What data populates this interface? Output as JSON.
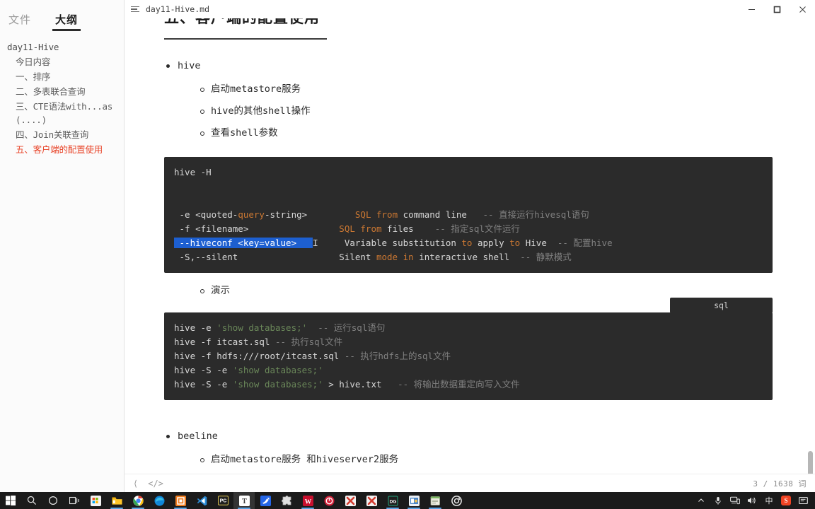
{
  "sidebar": {
    "tabs": [
      {
        "label": "文件",
        "active": false
      },
      {
        "label": "大纲",
        "active": true
      }
    ],
    "outline": [
      {
        "label": "day11-Hive",
        "level": 0,
        "active": false
      },
      {
        "label": "今日内容",
        "level": 1,
        "active": false
      },
      {
        "label": "一、排序",
        "level": 1,
        "active": false
      },
      {
        "label": "二、多表联合查询",
        "level": 1,
        "active": false
      },
      {
        "label": "三、CTE语法with...as(....)",
        "level": 1,
        "active": false
      },
      {
        "label": "四、Join关联查询",
        "level": 1,
        "active": false
      },
      {
        "label": "五、客户端的配置使用",
        "level": 1,
        "active": true
      }
    ],
    "active_color": "#e8452a"
  },
  "window": {
    "title": "day11-Hive.md",
    "menu_icon": "hamburger-icon",
    "controls": {
      "minimize": "minimize-icon",
      "maximize": "restore-icon",
      "close": "close-icon"
    }
  },
  "document": {
    "heading": "五、客户端的配置使用",
    "sections": [
      {
        "bullet": "hive",
        "children": [
          "启动metastore服务",
          "hive的其他shell操作",
          "查看shell参数"
        ]
      }
    ],
    "code_block_1": {
      "lines": [
        [
          {
            "t": "hive -H",
            "c": "txt"
          }
        ],
        [
          {
            "t": "",
            "c": "txt"
          }
        ],
        [
          {
            "t": "",
            "c": "txt"
          }
        ],
        [
          {
            "t": " -e <quoted-",
            "c": "txt"
          },
          {
            "t": "query",
            "c": "kw"
          },
          {
            "t": "-string>         ",
            "c": "txt"
          },
          {
            "t": "SQL from",
            "c": "kw"
          },
          {
            "t": " command line",
            "c": "txt"
          },
          {
            "t": "   -- 直接运行hivesql语句",
            "c": "cmt"
          }
        ],
        [
          {
            "t": " -f <filename>                 ",
            "c": "txt"
          },
          {
            "t": "SQL from",
            "c": "kw"
          },
          {
            "t": " files",
            "c": "txt"
          },
          {
            "t": "    -- 指定sql文件运行",
            "c": "cmt"
          }
        ],
        [
          {
            "t": " --hiveconf <key=value>   ",
            "c": "sel"
          },
          {
            "t": "CARET",
            "c": "caret"
          },
          {
            "t": "     Variable substitution ",
            "c": "txt"
          },
          {
            "t": "to",
            "c": "kw"
          },
          {
            "t": " apply ",
            "c": "txt"
          },
          {
            "t": "to",
            "c": "kw"
          },
          {
            "t": " Hive",
            "c": "txt"
          },
          {
            "t": "  -- 配置hive",
            "c": "cmt"
          }
        ],
        [
          {
            "t": " -S,--silent                   Silent ",
            "c": "txt"
          },
          {
            "t": "mode in",
            "c": "kw"
          },
          {
            "t": " interactive shell",
            "c": "txt"
          },
          {
            "t": "  -- 静默模式",
            "c": "cmt"
          }
        ]
      ]
    },
    "demo_label": "演示",
    "lang_badge": "sql",
    "code_block_2": {
      "lines": [
        [
          {
            "t": "hive -e ",
            "c": "txt"
          },
          {
            "t": "'show databases;'",
            "c": "str"
          },
          {
            "t": "  -- 运行sql语句",
            "c": "cmt"
          }
        ],
        [
          {
            "t": "hive -f itcast.sql",
            "c": "txt"
          },
          {
            "t": " -- 执行sql文件",
            "c": "cmt"
          }
        ],
        [
          {
            "t": "hive -f hdfs:///root/itcast.sql",
            "c": "txt"
          },
          {
            "t": " -- 执行hdfs上的sql文件",
            "c": "cmt"
          }
        ],
        [
          {
            "t": "hive -S -e ",
            "c": "txt"
          },
          {
            "t": "'show databases;'",
            "c": "str"
          }
        ],
        [
          {
            "t": "hive -S -e ",
            "c": "txt"
          },
          {
            "t": "'show databases;'",
            "c": "str"
          },
          {
            "t": " > hive.txt",
            "c": "txt"
          },
          {
            "t": "   -- 将输出数据重定向写入文件",
            "c": "cmt"
          }
        ]
      ]
    },
    "sections2": [
      {
        "bullet": "beeline",
        "children": [
          "启动metastore服务 和hiveserver2服务"
        ]
      }
    ]
  },
  "statusbar": {
    "back_icon": "chevron-left-icon",
    "source_icon": "code-brackets-icon",
    "word_count": "3 / 1638 词"
  },
  "taskbar": {
    "items": [
      {
        "name": "start-button",
        "glyph": "windows-icon",
        "color": "#1b1b1b",
        "active": false,
        "running": false
      },
      {
        "name": "search-button",
        "glyph": "search-icon",
        "color": "#1b1b1b",
        "active": false,
        "running": false
      },
      {
        "name": "cortana-button",
        "glyph": "circle-icon",
        "color": "#1b1b1b",
        "active": false,
        "running": false
      },
      {
        "name": "task-view-button",
        "glyph": "taskview-icon",
        "color": "#1b1b1b",
        "active": false,
        "running": false
      },
      {
        "name": "store-app",
        "glyph": "store-icon",
        "color": "#f2f2f2",
        "active": false,
        "running": false
      },
      {
        "name": "file-explorer-app",
        "glyph": "folder-icon",
        "color": "#ffb900",
        "active": false,
        "running": true
      },
      {
        "name": "chrome-app",
        "glyph": "chrome-icon",
        "color": "#4285f4",
        "active": false,
        "running": true
      },
      {
        "name": "edge-app",
        "glyph": "edge-icon",
        "color": "#0078d7",
        "active": false,
        "running": false
      },
      {
        "name": "vmware-app",
        "glyph": "vmware-icon",
        "color": "#f0820f",
        "active": false,
        "running": true
      },
      {
        "name": "vscode-app",
        "glyph": "vscode-icon",
        "color": "#2d8cd6",
        "active": false,
        "running": false
      },
      {
        "name": "pc-app",
        "glyph": "pc-icon",
        "color": "#1f1f1f",
        "active": false,
        "running": false
      },
      {
        "name": "typora-app",
        "glyph": "typora-icon",
        "color": "#ffffff",
        "active": true,
        "running": true
      },
      {
        "name": "feishu-app",
        "glyph": "feishu-icon",
        "color": "#2566e8",
        "active": false,
        "running": false
      },
      {
        "name": "puzzle-app",
        "glyph": "puzzle-icon",
        "color": "#e8e8e8",
        "active": false,
        "running": false
      },
      {
        "name": "wps-app",
        "glyph": "wps-icon",
        "color": "#c8102e",
        "active": false,
        "running": true
      },
      {
        "name": "clock-app",
        "glyph": "timer-icon",
        "color": "#d2223a",
        "active": false,
        "running": false
      },
      {
        "name": "xshell-app",
        "glyph": "x-icon",
        "color": "#d43b2f",
        "active": false,
        "running": false
      },
      {
        "name": "xftp-app",
        "glyph": "x-icon",
        "color": "#d43b2f",
        "active": false,
        "running": false
      },
      {
        "name": "datagrip-app",
        "glyph": "dg-icon",
        "color": "#21a179",
        "active": false,
        "running": true
      },
      {
        "name": "navicat-app",
        "glyph": "navicat-icon",
        "color": "#4a86c8",
        "active": false,
        "running": true
      },
      {
        "name": "notepad-app",
        "glyph": "notepad-icon",
        "color": "#7bb661",
        "active": false,
        "running": true
      },
      {
        "name": "disc-app",
        "glyph": "disc-icon",
        "color": "#e6e6e6",
        "active": false,
        "running": false
      }
    ],
    "tray": [
      {
        "name": "show-hidden-icons",
        "glyph": "chevron-up-icon",
        "label": "⌃"
      },
      {
        "name": "microphone-icon",
        "glyph": "microphone-icon",
        "label": ""
      },
      {
        "name": "network-icon",
        "glyph": "network-icon",
        "label": ""
      },
      {
        "name": "volume-icon",
        "glyph": "volume-icon",
        "label": ""
      },
      {
        "name": "ime-indicator",
        "glyph": "ime-icon",
        "label": "中"
      },
      {
        "name": "snipping-tool-icon",
        "glyph": "snip-icon",
        "label": "S"
      },
      {
        "name": "action-center-icon",
        "glyph": "notification-icon",
        "label": ""
      }
    ]
  }
}
